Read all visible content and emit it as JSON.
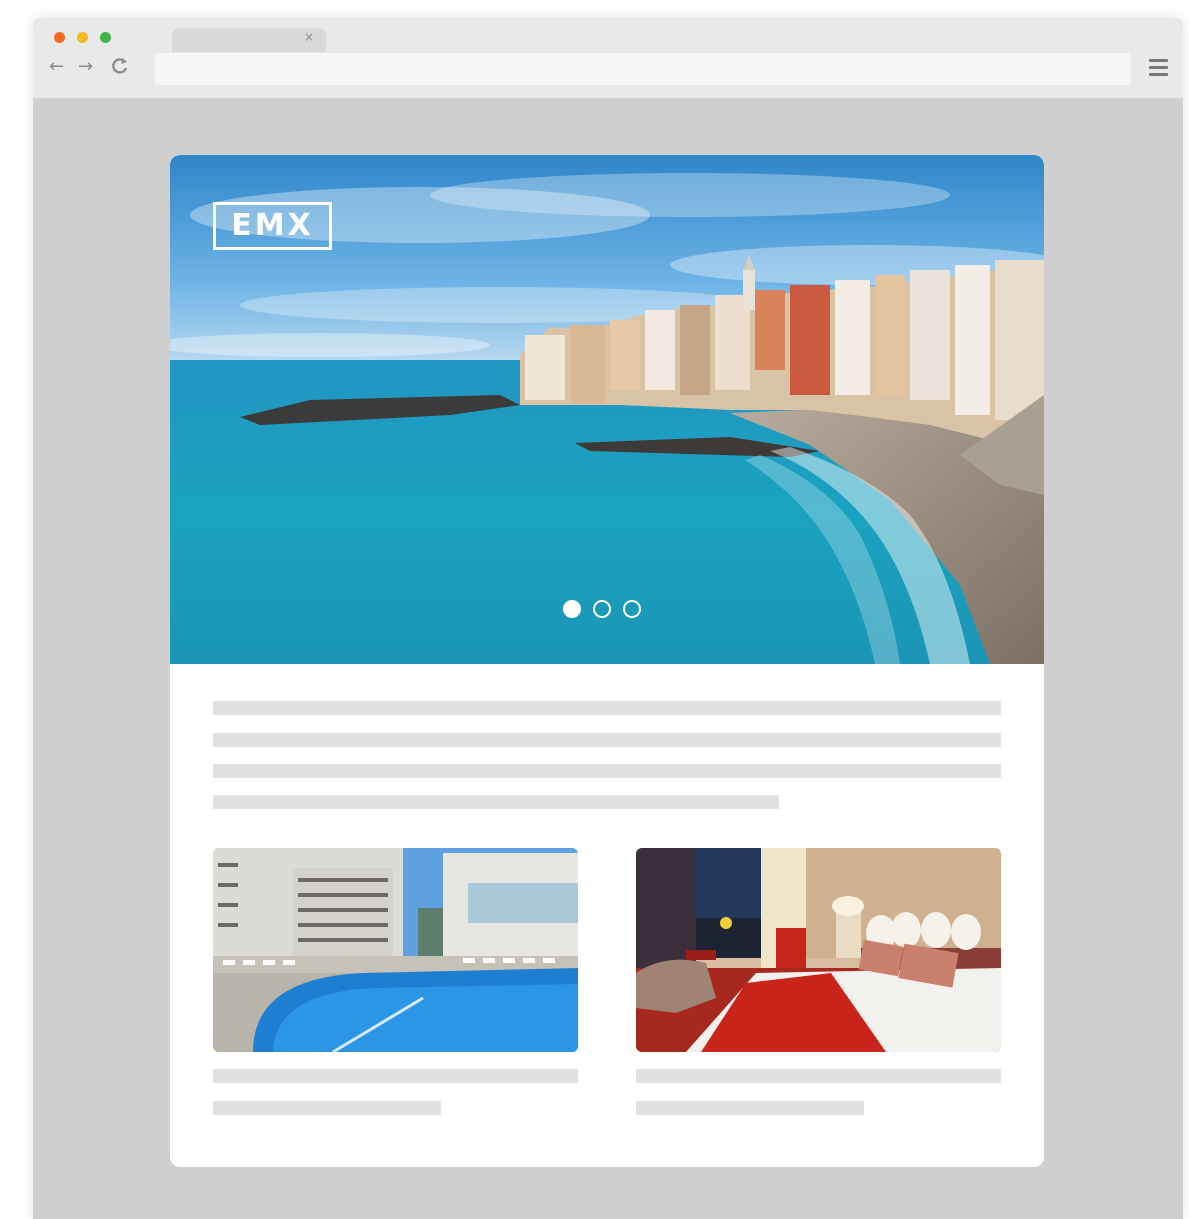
{
  "browser": {
    "tab_close": "×",
    "nav": {
      "back": "←",
      "forward": "→",
      "reload": "C"
    },
    "url": ""
  },
  "hero": {
    "logo_text": "EMX",
    "carousel": {
      "slide_count": 3,
      "active_index": 0
    }
  },
  "icons": {
    "window_controls": [
      "close-dot-icon",
      "minimize-dot-icon",
      "maximize-dot-icon"
    ],
    "menu": "hamburger-menu-icon"
  },
  "colors": {
    "window_close": "#f26b21",
    "window_min": "#f5b921",
    "window_max": "#3cb54a",
    "page_background": "#cfcfcf",
    "placeholder_bar": "#e1e1e1"
  }
}
